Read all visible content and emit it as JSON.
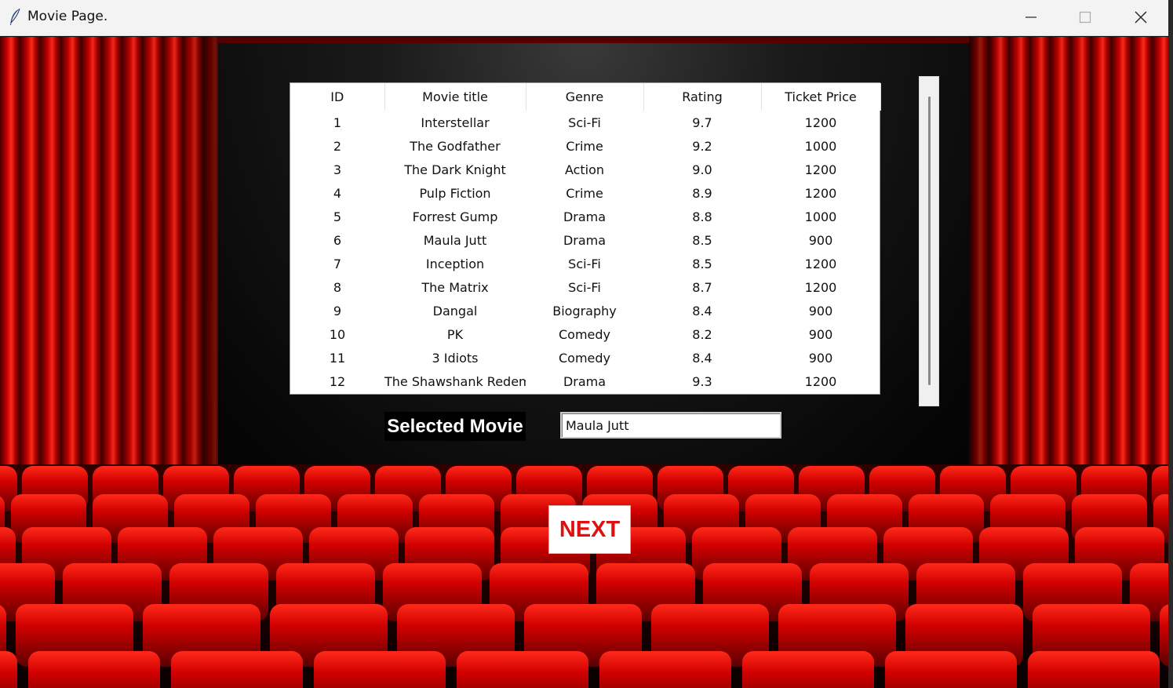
{
  "window": {
    "title": "Movie Page.",
    "icon": "feather-icon",
    "controls": [
      "minimize-icon",
      "maximize-icon",
      "close-icon"
    ]
  },
  "table": {
    "columns": [
      "ID",
      "Movie title",
      "Genre",
      "Rating",
      "Ticket Price"
    ],
    "rows": [
      [
        "1",
        "Interstellar",
        "Sci-Fi",
        "9.7",
        "1200"
      ],
      [
        "2",
        "The Godfather",
        "Crime",
        "9.2",
        "1000"
      ],
      [
        "3",
        "The Dark Knight",
        "Action",
        "9.0",
        "1200"
      ],
      [
        "4",
        "Pulp Fiction",
        "Crime",
        "8.9",
        "1200"
      ],
      [
        "5",
        "Forrest Gump",
        "Drama",
        "8.8",
        "1000"
      ],
      [
        "6",
        "Maula Jutt",
        "Drama",
        "8.5",
        "900"
      ],
      [
        "7",
        "Inception",
        "Sci-Fi",
        "8.5",
        "1200"
      ],
      [
        "8",
        "The Matrix",
        "Sci-Fi",
        "8.7",
        "1200"
      ],
      [
        "9",
        "Dangal",
        "Biography",
        "8.4",
        "900"
      ],
      [
        "10",
        "PK",
        "Comedy",
        "8.2",
        "900"
      ],
      [
        "11",
        "3 Idiots",
        "Comedy",
        "8.4",
        "900"
      ],
      [
        "12",
        "The Shawshank Redemption",
        "Drama",
        "9.3",
        "1200"
      ]
    ]
  },
  "selection": {
    "label": "Selected Movie",
    "value": "Maula Jutt"
  },
  "next_button": {
    "label": "NEXT"
  },
  "colors": {
    "curtain": "#c00000",
    "seat": "#c40000",
    "next_text": "#e01010",
    "background": "#000000"
  }
}
